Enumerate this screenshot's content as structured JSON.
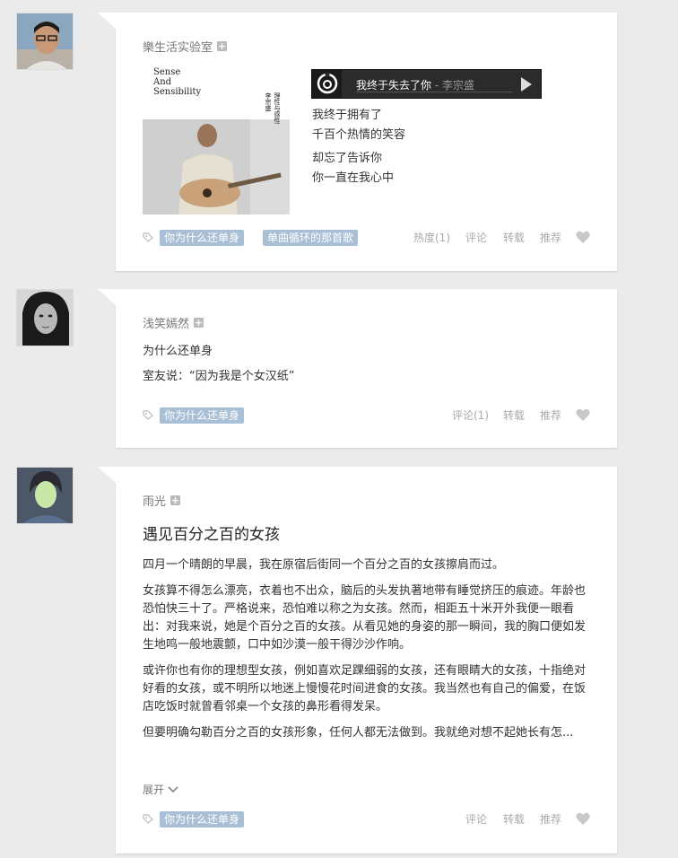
{
  "posts": [
    {
      "author": "樂生活实验室",
      "player": {
        "song": "我终于失去了你",
        "separator": " - ",
        "artist": "李宗盛"
      },
      "cover": {
        "title_lines": [
          "Sense",
          "And",
          "Sensibility"
        ]
      },
      "lyrics": [
        "我终于拥有了",
        "千百个热情的笑容",
        "却忘了告诉你",
        "你一直在我心中"
      ],
      "tags": [
        "你为什么还单身",
        "单曲循环的那首歌"
      ],
      "actions": [
        "热度(1)",
        "评论",
        "转载",
        "推荐"
      ]
    },
    {
      "author": "浅笑嫣然",
      "lines": [
        "为什么还单身",
        "室友说：“因为我是个女汉纸”"
      ],
      "tags": [
        "你为什么还单身"
      ],
      "actions": [
        "评论(1)",
        "转载",
        "推荐"
      ]
    },
    {
      "author": "雨光",
      "title": "遇见百分之百的女孩",
      "paragraphs": [
        "四月一个晴朗的早晨，我在原宿后街同一个百分之百的女孩擦肩而过。",
        "女孩算不得怎么漂亮，衣着也不出众，脑后的头发执著地带有睡觉挤压的痕迹。年龄也恐怕快三十了。严格说来，恐怕难以称之为女孩。然而，相距五十米开外我便一眼看出：对我来说，她是个百分之百的女孩。从看见她的身姿的那一瞬间，我的胸口便如发生地鸣一般地震颤，口中如沙漠一般干得沙沙作响。",
        "或许你也有你的理想型女孩，例如喜欢足踝细弱的女孩，还有眼睛大的女孩，十指绝对好看的女孩，或不明所以地迷上慢慢花时间进食的女孩。我当然也有自己的偏爱，在饭店吃饭时就曾看邻桌一个女孩的鼻形看得发呆。",
        "但要明确勾勒百分之百的女孩形象，任何人都无法做到。我就绝对想不起她长有怎..."
      ],
      "expand_label": "展开",
      "tags": [
        "你为什么还单身"
      ],
      "actions": [
        "评论",
        "转载",
        "推荐"
      ]
    }
  ],
  "colors": {
    "tag": "#a9bfd6",
    "background": "#ebebeb"
  }
}
